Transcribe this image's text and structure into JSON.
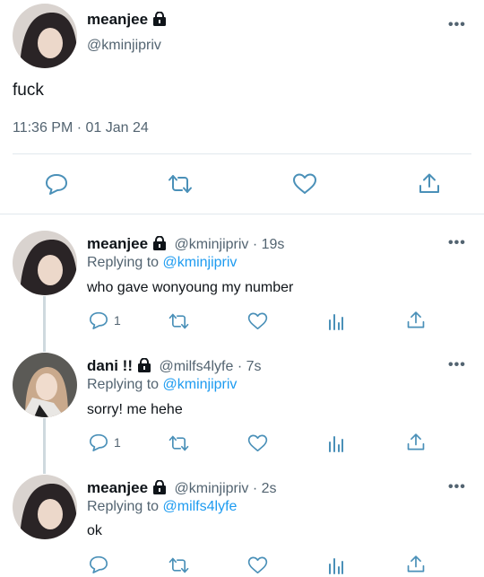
{
  "main_tweet": {
    "name": "meanjee",
    "handle": "@kminjipriv",
    "text": "fuck",
    "timestamp": "11:36 PM · 01 Jan 24",
    "more": "•••"
  },
  "replies": [
    {
      "name": "meanjee",
      "handle_time": "@kminjipriv · 19s",
      "replying_prefix": "Replying to",
      "replying_to": "@kminjipriv",
      "text": "who gave wonyoung my number",
      "reply_count": "1",
      "more": "•••"
    },
    {
      "name": "dani !!",
      "handle_time": "@milfs4lyfe · 7s",
      "replying_prefix": "Replying to",
      "replying_to": "@kminjipriv",
      "text": "sorry! me hehe",
      "reply_count": "1",
      "more": "•••"
    },
    {
      "name": "meanjee",
      "handle_time": "@kminjipriv · 2s",
      "replying_prefix": "Replying to",
      "replying_to": "@milfs4lyfe",
      "text": "ok",
      "reply_count": "",
      "more": "•••"
    }
  ],
  "colors": {
    "accent": "#1d9bf0",
    "secondary_text": "#536471",
    "divider": "#e1e8ed"
  }
}
